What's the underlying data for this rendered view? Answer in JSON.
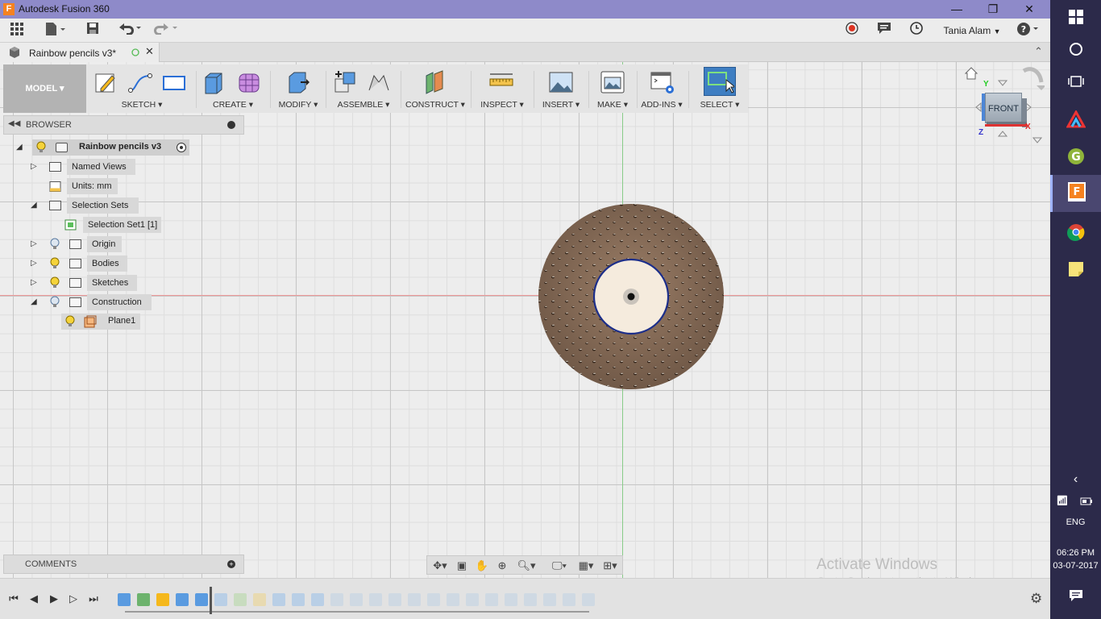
{
  "window": {
    "app_title": "Autodesk Fusion 360",
    "app_icon_letter": "F",
    "minimize": "—",
    "maximize": "❐",
    "close": "✕"
  },
  "qat": {
    "user_name": "Tania Alam"
  },
  "document_tab": {
    "name": "Rainbow pencils v3*"
  },
  "toolbar": {
    "workspace": "MODEL ▾",
    "groups": [
      "SKETCH ▾",
      "CREATE ▾",
      "MODIFY ▾",
      "ASSEMBLE ▾",
      "CONSTRUCT ▾",
      "INSPECT ▾",
      "INSERT ▾",
      "MAKE ▾",
      "ADD-INS ▾",
      "SELECT ▾"
    ]
  },
  "browser": {
    "title": "BROWSER",
    "root": "Rainbow pencils v3",
    "items": [
      "Named Views",
      "Units: mm",
      "Selection Sets",
      "Selection Set1 [1]",
      "Origin",
      "Bodies",
      "Sketches",
      "Construction",
      "Plane1"
    ]
  },
  "comments": {
    "title": "COMMENTS"
  },
  "viewcube": {
    "face": "FRONT",
    "axis_y": "Y",
    "axis_x": "X",
    "axis_z": "Z"
  },
  "watermark": {
    "line1": "Activate Windows",
    "line2": "Go to Settings to activate Windows."
  },
  "taskbar": {
    "language": "ENG",
    "time": "06:26 PM",
    "date": "03-07-2017"
  },
  "colors": {
    "title_bar": "#8e8ac9",
    "taskbar": "#2c2a4a",
    "axis_red": "#e99999",
    "axis_green": "#88cc88",
    "body_brown": "#8b6f59",
    "bore": "#f5ebdd"
  }
}
